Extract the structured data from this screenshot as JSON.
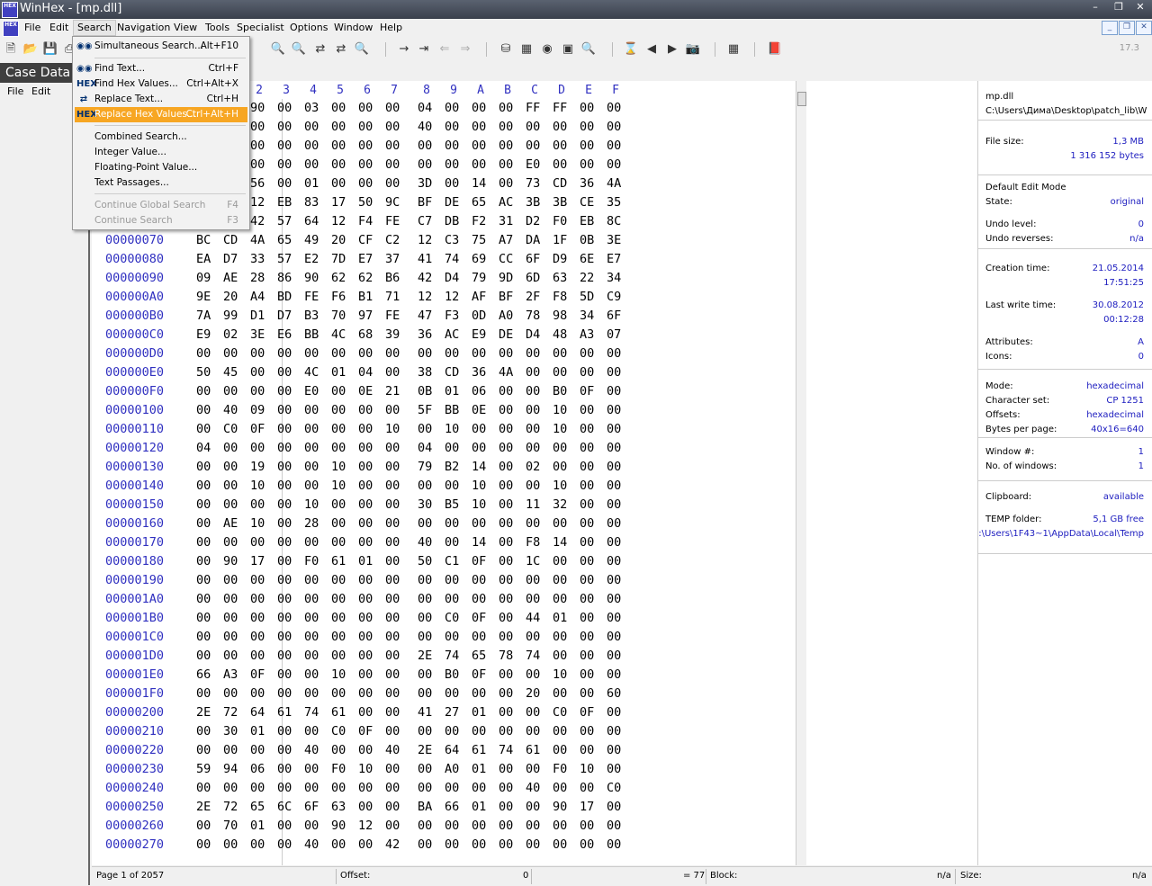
{
  "window": {
    "title": "WinHex - [mp.dll]"
  },
  "menubar": [
    "File",
    "Edit",
    "Search",
    "Navigation",
    "View",
    "Tools",
    "Specialist",
    "Options",
    "Window",
    "Help"
  ],
  "version": "17.3",
  "case_data": {
    "title": "Case Data",
    "menu": [
      "File",
      "Edit"
    ]
  },
  "search_menu": {
    "items": [
      {
        "label": "Simultaneous Search...",
        "shortcut": "Alt+F10"
      },
      {
        "label": "Find Text...",
        "shortcut": "Ctrl+F"
      },
      {
        "label": "Find Hex Values...",
        "shortcut": "Ctrl+Alt+X"
      },
      {
        "label": "Replace Text...",
        "shortcut": "Ctrl+H"
      },
      {
        "label": "Replace Hex Values...",
        "shortcut": "Ctrl+Alt+H"
      },
      {
        "label": "Combined Search...",
        "shortcut": ""
      },
      {
        "label": "Integer Value...",
        "shortcut": ""
      },
      {
        "label": "Floating-Point Value...",
        "shortcut": ""
      },
      {
        "label": "Text Passages...",
        "shortcut": ""
      },
      {
        "label": "Continue Global Search",
        "shortcut": "F4"
      },
      {
        "label": "Continue Search",
        "shortcut": "F3"
      }
    ]
  },
  "hex": {
    "columns": [
      "2",
      "3",
      "4",
      "5",
      "6",
      "7",
      "8",
      "9",
      "A",
      "B",
      "C",
      "D",
      "E",
      "F"
    ],
    "rows": [
      {
        "off": "",
        "bytes": [
          "90",
          "00",
          "03",
          "00",
          "00",
          "00",
          "04",
          "00",
          "00",
          "00",
          "FF",
          "FF",
          "00",
          "00"
        ]
      },
      {
        "off": "",
        "bytes": [
          "00",
          "00",
          "00",
          "00",
          "00",
          "00",
          "40",
          "00",
          "00",
          "00",
          "00",
          "00",
          "00",
          "00"
        ]
      },
      {
        "off": "",
        "bytes": [
          "00",
          "00",
          "00",
          "00",
          "00",
          "00",
          "00",
          "00",
          "00",
          "00",
          "00",
          "00",
          "00",
          "00"
        ]
      },
      {
        "off": "",
        "bytes": [
          "00",
          "00",
          "00",
          "00",
          "00",
          "00",
          "00",
          "00",
          "00",
          "00",
          "E0",
          "00",
          "00",
          "00"
        ]
      },
      {
        "off": "",
        "bytes": [
          "56",
          "00",
          "01",
          "00",
          "00",
          "00",
          "3D",
          "00",
          "14",
          "00",
          "73",
          "CD",
          "36",
          "4A"
        ]
      },
      {
        "off": "",
        "bytes": [
          "12",
          "EB",
          "83",
          "17",
          "50",
          "9C",
          "BF",
          "DE",
          "65",
          "AC",
          "3B",
          "3B",
          "CE",
          "35"
        ]
      },
      {
        "off": "",
        "bytes": [
          "42",
          "57",
          "64",
          "12",
          "F4",
          "FE",
          "C7",
          "DB",
          "F2",
          "31",
          "D2",
          "F0",
          "EB",
          "8C"
        ]
      },
      {
        "off": "00000070",
        "bytes": [
          "BC",
          "CD",
          "4A",
          "65",
          "49",
          "20",
          "CF",
          "C2",
          "12",
          "C3",
          "75",
          "A7",
          "DA",
          "1F",
          "0B",
          "3E"
        ]
      },
      {
        "off": "00000080",
        "bytes": [
          "EA",
          "D7",
          "33",
          "57",
          "E2",
          "7D",
          "E7",
          "37",
          "41",
          "74",
          "69",
          "CC",
          "6F",
          "D9",
          "6E",
          "E7"
        ]
      },
      {
        "off": "00000090",
        "bytes": [
          "09",
          "AE",
          "28",
          "86",
          "90",
          "62",
          "62",
          "B6",
          "42",
          "D4",
          "79",
          "9D",
          "6D",
          "63",
          "22",
          "34"
        ]
      },
      {
        "off": "000000A0",
        "bytes": [
          "9E",
          "20",
          "A4",
          "BD",
          "FE",
          "F6",
          "B1",
          "71",
          "12",
          "12",
          "AF",
          "BF",
          "2F",
          "F8",
          "5D",
          "C9"
        ]
      },
      {
        "off": "000000B0",
        "bytes": [
          "7A",
          "99",
          "D1",
          "D7",
          "B3",
          "70",
          "97",
          "FE",
          "47",
          "F3",
          "0D",
          "A0",
          "78",
          "98",
          "34",
          "6F"
        ]
      },
      {
        "off": "000000C0",
        "bytes": [
          "E9",
          "02",
          "3E",
          "E6",
          "BB",
          "4C",
          "68",
          "39",
          "36",
          "AC",
          "E9",
          "DE",
          "D4",
          "48",
          "A3",
          "07"
        ]
      },
      {
        "off": "000000D0",
        "bytes": [
          "00",
          "00",
          "00",
          "00",
          "00",
          "00",
          "00",
          "00",
          "00",
          "00",
          "00",
          "00",
          "00",
          "00",
          "00",
          "00"
        ]
      },
      {
        "off": "000000E0",
        "bytes": [
          "50",
          "45",
          "00",
          "00",
          "4C",
          "01",
          "04",
          "00",
          "38",
          "CD",
          "36",
          "4A",
          "00",
          "00",
          "00",
          "00"
        ]
      },
      {
        "off": "000000F0",
        "bytes": [
          "00",
          "00",
          "00",
          "00",
          "E0",
          "00",
          "0E",
          "21",
          "0B",
          "01",
          "06",
          "00",
          "00",
          "B0",
          "0F",
          "00"
        ]
      },
      {
        "off": "00000100",
        "bytes": [
          "00",
          "40",
          "09",
          "00",
          "00",
          "00",
          "00",
          "00",
          "5F",
          "BB",
          "0E",
          "00",
          "00",
          "10",
          "00",
          "00"
        ]
      },
      {
        "off": "00000110",
        "bytes": [
          "00",
          "C0",
          "0F",
          "00",
          "00",
          "00",
          "00",
          "10",
          "00",
          "10",
          "00",
          "00",
          "00",
          "10",
          "00",
          "00"
        ]
      },
      {
        "off": "00000120",
        "bytes": [
          "04",
          "00",
          "00",
          "00",
          "00",
          "00",
          "00",
          "00",
          "04",
          "00",
          "00",
          "00",
          "00",
          "00",
          "00",
          "00"
        ]
      },
      {
        "off": "00000130",
        "bytes": [
          "00",
          "00",
          "19",
          "00",
          "00",
          "10",
          "00",
          "00",
          "79",
          "B2",
          "14",
          "00",
          "02",
          "00",
          "00",
          "00"
        ]
      },
      {
        "off": "00000140",
        "bytes": [
          "00",
          "00",
          "10",
          "00",
          "00",
          "10",
          "00",
          "00",
          "00",
          "00",
          "10",
          "00",
          "00",
          "10",
          "00",
          "00"
        ]
      },
      {
        "off": "00000150",
        "bytes": [
          "00",
          "00",
          "00",
          "00",
          "10",
          "00",
          "00",
          "00",
          "30",
          "B5",
          "10",
          "00",
          "11",
          "32",
          "00",
          "00"
        ]
      },
      {
        "off": "00000160",
        "bytes": [
          "00",
          "AE",
          "10",
          "00",
          "28",
          "00",
          "00",
          "00",
          "00",
          "00",
          "00",
          "00",
          "00",
          "00",
          "00",
          "00"
        ]
      },
      {
        "off": "00000170",
        "bytes": [
          "00",
          "00",
          "00",
          "00",
          "00",
          "00",
          "00",
          "00",
          "40",
          "00",
          "14",
          "00",
          "F8",
          "14",
          "00",
          "00"
        ]
      },
      {
        "off": "00000180",
        "bytes": [
          "00",
          "90",
          "17",
          "00",
          "F0",
          "61",
          "01",
          "00",
          "50",
          "C1",
          "0F",
          "00",
          "1C",
          "00",
          "00",
          "00"
        ]
      },
      {
        "off": "00000190",
        "bytes": [
          "00",
          "00",
          "00",
          "00",
          "00",
          "00",
          "00",
          "00",
          "00",
          "00",
          "00",
          "00",
          "00",
          "00",
          "00",
          "00"
        ]
      },
      {
        "off": "000001A0",
        "bytes": [
          "00",
          "00",
          "00",
          "00",
          "00",
          "00",
          "00",
          "00",
          "00",
          "00",
          "00",
          "00",
          "00",
          "00",
          "00",
          "00"
        ]
      },
      {
        "off": "000001B0",
        "bytes": [
          "00",
          "00",
          "00",
          "00",
          "00",
          "00",
          "00",
          "00",
          "00",
          "C0",
          "0F",
          "00",
          "44",
          "01",
          "00",
          "00"
        ]
      },
      {
        "off": "000001C0",
        "bytes": [
          "00",
          "00",
          "00",
          "00",
          "00",
          "00",
          "00",
          "00",
          "00",
          "00",
          "00",
          "00",
          "00",
          "00",
          "00",
          "00"
        ]
      },
      {
        "off": "000001D0",
        "bytes": [
          "00",
          "00",
          "00",
          "00",
          "00",
          "00",
          "00",
          "00",
          "2E",
          "74",
          "65",
          "78",
          "74",
          "00",
          "00",
          "00"
        ]
      },
      {
        "off": "000001E0",
        "bytes": [
          "66",
          "A3",
          "0F",
          "00",
          "00",
          "10",
          "00",
          "00",
          "00",
          "B0",
          "0F",
          "00",
          "00",
          "10",
          "00",
          "00"
        ]
      },
      {
        "off": "000001F0",
        "bytes": [
          "00",
          "00",
          "00",
          "00",
          "00",
          "00",
          "00",
          "00",
          "00",
          "00",
          "00",
          "00",
          "20",
          "00",
          "00",
          "60"
        ]
      },
      {
        "off": "00000200",
        "bytes": [
          "2E",
          "72",
          "64",
          "61",
          "74",
          "61",
          "00",
          "00",
          "41",
          "27",
          "01",
          "00",
          "00",
          "C0",
          "0F",
          "00"
        ]
      },
      {
        "off": "00000210",
        "bytes": [
          "00",
          "30",
          "01",
          "00",
          "00",
          "C0",
          "0F",
          "00",
          "00",
          "00",
          "00",
          "00",
          "00",
          "00",
          "00",
          "00"
        ]
      },
      {
        "off": "00000220",
        "bytes": [
          "00",
          "00",
          "00",
          "00",
          "40",
          "00",
          "00",
          "40",
          "2E",
          "64",
          "61",
          "74",
          "61",
          "00",
          "00",
          "00"
        ]
      },
      {
        "off": "00000230",
        "bytes": [
          "59",
          "94",
          "06",
          "00",
          "00",
          "F0",
          "10",
          "00",
          "00",
          "A0",
          "01",
          "00",
          "00",
          "F0",
          "10",
          "00"
        ]
      },
      {
        "off": "00000240",
        "bytes": [
          "00",
          "00",
          "00",
          "00",
          "00",
          "00",
          "00",
          "00",
          "00",
          "00",
          "00",
          "00",
          "40",
          "00",
          "00",
          "C0"
        ]
      },
      {
        "off": "00000250",
        "bytes": [
          "2E",
          "72",
          "65",
          "6C",
          "6F",
          "63",
          "00",
          "00",
          "BA",
          "66",
          "01",
          "00",
          "00",
          "90",
          "17",
          "00"
        ]
      },
      {
        "off": "00000260",
        "bytes": [
          "00",
          "70",
          "01",
          "00",
          "00",
          "90",
          "12",
          "00",
          "00",
          "00",
          "00",
          "00",
          "00",
          "00",
          "00",
          "00"
        ]
      },
      {
        "off": "00000270",
        "bytes": [
          "00",
          "00",
          "00",
          "00",
          "40",
          "00",
          "00",
          "42",
          "00",
          "00",
          "00",
          "00",
          "00",
          "00",
          "00",
          "00"
        ]
      }
    ]
  },
  "info": {
    "filename": "mp.dll",
    "path": "C:\\Users\\Дима\\Desktop\\patch_lib\\W",
    "file_size_label": "File size:",
    "file_size_mb": "1,3 MB",
    "file_size_bytes": "1 316 152 bytes",
    "edit_mode": "Default Edit Mode",
    "state_label": "State:",
    "state": "original",
    "undo_level_label": "Undo level:",
    "undo_level": "0",
    "undo_reverses_label": "Undo reverses:",
    "undo_reverses": "n/a",
    "creation_label": "Creation time:",
    "creation_date": "21.05.2014",
    "creation_time": "17:51:25",
    "lastwrite_label": "Last write time:",
    "lastwrite_date": "30.08.2012",
    "lastwrite_time": "00:12:28",
    "attributes_label": "Attributes:",
    "attributes": "A",
    "icons_label": "Icons:",
    "icons": "0",
    "mode_label": "Mode:",
    "mode": "hexadecimal",
    "charset_label": "Character set:",
    "charset": "CP 1251",
    "offsets_label": "Offsets:",
    "offsets": "hexadecimal",
    "bpp_label": "Bytes per page:",
    "bpp": "40x16=640",
    "window_label": "Window #:",
    "window": "1",
    "nwin_label": "No. of windows:",
    "nwin": "1",
    "clipboard_label": "Clipboard:",
    "clipboard": "available",
    "temp_label": "TEMP folder:",
    "temp_free": "5,1 GB free",
    "temp_path": ":\\Users\\1F43~1\\AppData\\Local\\Temp"
  },
  "status": {
    "page": "Page 1 of 2057",
    "offset_label": "Offset:",
    "offset_value": "0",
    "eq_value": "= 77",
    "block_label": "Block:",
    "block_value": "n/a",
    "size_label": "Size:",
    "size_value": "n/a"
  }
}
